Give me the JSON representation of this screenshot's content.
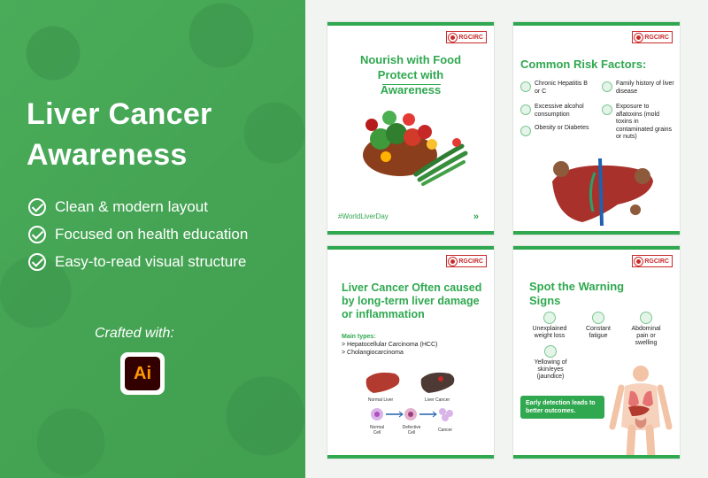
{
  "left": {
    "title": "Liver Cancer Awareness",
    "features": [
      "Clean & modern layout",
      "Focused on health education",
      "Easy-to-read visual structure"
    ],
    "crafted_with": "Crafted with:",
    "ai_logo": "Ai"
  },
  "brand": "RGCIRC",
  "cards": {
    "food": {
      "heading": "Nourish with Food Protect with Awareness",
      "hashtag": "#WorldLiverDay",
      "arrows": "»"
    },
    "risk": {
      "heading": "Common Risk Factors:",
      "items": [
        "Chronic Hepatitis B or C",
        "Family history of liver disease",
        "Excessive alcohol consumption",
        "Exposure to aflatoxins (mold toxins in contaminated grains or nuts)",
        "Obesity or Diabetes"
      ]
    },
    "types": {
      "heading": "Liver Cancer Often caused by long-term liver damage or inflammation",
      "main_types_label": "Main types:",
      "types": [
        "> Hepatocellular Carcinoma (HCC)",
        "> Cholangiocarcinoma"
      ],
      "labels": [
        "Normal Liver",
        "Liver Cancer",
        "Normal Cell",
        "Defective Cell",
        "Cancer"
      ]
    },
    "signs": {
      "heading": "Spot the Warning Signs",
      "items": [
        "Unexplained weight loss",
        "Constant fatigue",
        "Abdominal pain or swelling",
        "Yellowing of skin/eyes (jaundice)"
      ],
      "banner": "Early detection leads to better outcomes."
    }
  },
  "colors": {
    "green": "#2fa84f",
    "panel": "#4caf5c",
    "brand_red": "#c92a2a",
    "ai_bg": "#330000",
    "ai_fg": "#ff9a00"
  }
}
